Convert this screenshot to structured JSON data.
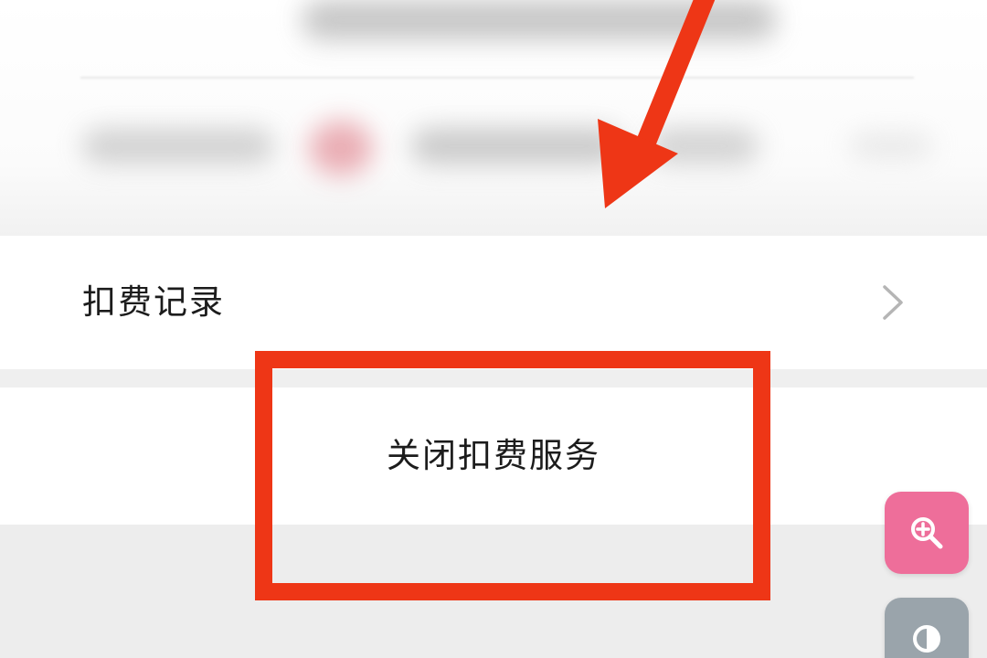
{
  "record_row": {
    "label": "扣费记录"
  },
  "close_service": {
    "label": "关闭扣费服务"
  },
  "icons": {
    "chevron": "chevron-right-icon",
    "zoom": "zoom-in-icon",
    "contrast": "contrast-icon"
  },
  "colors": {
    "annotation_red": "#ee3616",
    "zoom_button": "#ee6e9a",
    "contrast_button": "#9aa4ab"
  }
}
